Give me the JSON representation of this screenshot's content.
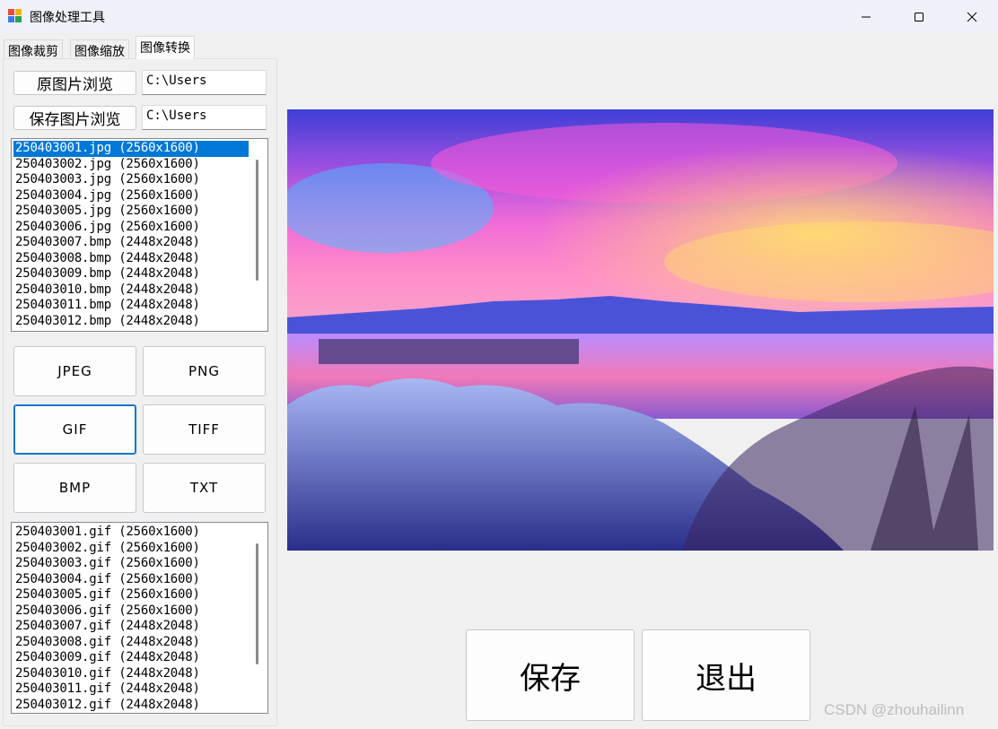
{
  "window": {
    "title": "图像处理工具"
  },
  "tabs": [
    {
      "label": "图像裁剪"
    },
    {
      "label": "图像缩放"
    },
    {
      "label": "图像转换"
    }
  ],
  "source": {
    "browse_label": "原图片浏览",
    "path_value": "C:\\Users"
  },
  "destination": {
    "browse_label": "保存图片浏览",
    "path_value": "C:\\Users"
  },
  "source_list": {
    "items": [
      "250403001.jpg (2560x1600)",
      "250403002.jpg (2560x1600)",
      "250403003.jpg (2560x1600)",
      "250403004.jpg (2560x1600)",
      "250403005.jpg (2560x1600)",
      "250403006.jpg (2560x1600)",
      "250403007.bmp (2448x2048)",
      "250403008.bmp (2448x2048)",
      "250403009.bmp (2448x2048)",
      "250403010.bmp (2448x2048)",
      "250403011.bmp (2448x2048)",
      "250403012.bmp (2448x2048)"
    ],
    "selected_index": 0
  },
  "formats": {
    "jpeg": "JPEG",
    "png": "PNG",
    "gif": "GIF",
    "tiff": "TIFF",
    "bmp": "BMP",
    "txt": "TXT"
  },
  "output_list": {
    "items": [
      "250403001.gif (2560x1600)",
      "250403002.gif (2560x1600)",
      "250403003.gif (2560x1600)",
      "250403004.gif (2560x1600)",
      "250403005.gif (2560x1600)",
      "250403006.gif (2560x1600)",
      "250403007.gif (2448x2048)",
      "250403008.gif (2448x2048)",
      "250403009.gif (2448x2048)",
      "250403010.gif (2448x2048)",
      "250403011.gif (2448x2048)",
      "250403012.gif (2448x2048)"
    ]
  },
  "actions": {
    "save_label": "保存",
    "exit_label": "退出"
  },
  "watermark": "CSDN @zhouhailinn",
  "colors": {
    "selection": "#0078d7",
    "focus_border": "#1874d2"
  }
}
